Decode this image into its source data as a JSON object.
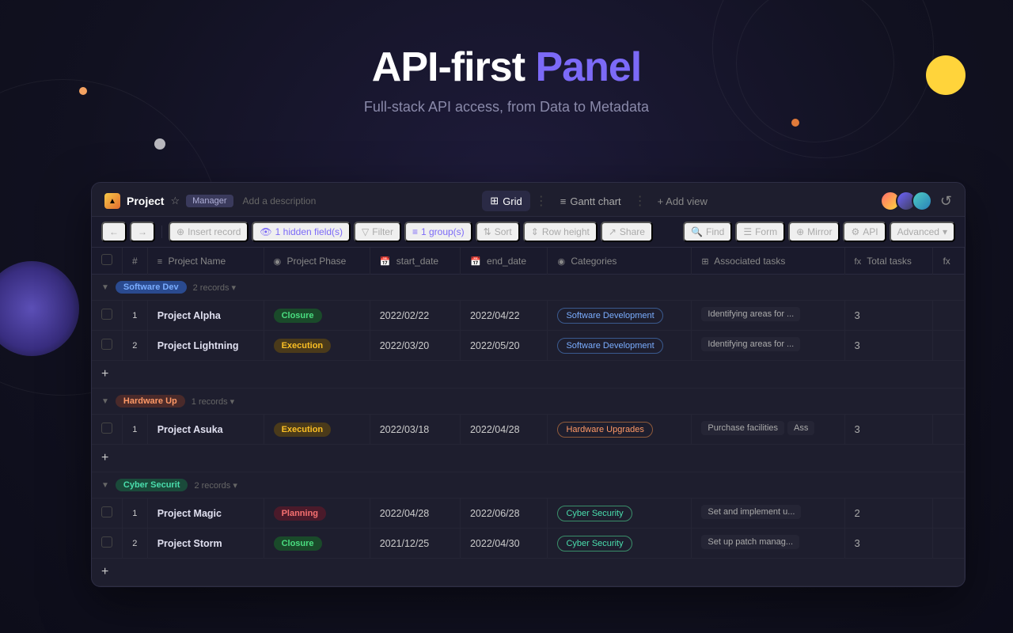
{
  "hero": {
    "title_plain": "API-first",
    "title_accent": "Panel",
    "subtitle": "Full-stack API access, from Data to Metadata"
  },
  "panel": {
    "project_label": "Project",
    "manager_badge": "Manager",
    "add_description": "Add a description",
    "tabs": [
      {
        "id": "grid",
        "icon": "⊞",
        "label": "Grid",
        "active": true
      },
      {
        "id": "gantt",
        "icon": "≡",
        "label": "Gantt chart",
        "active": false
      }
    ],
    "add_view_label": "+ Add view"
  },
  "toolbar": {
    "insert_record": "Insert record",
    "hidden_fields": "1 hidden field(s)",
    "filter": "Filter",
    "group": "1 group(s)",
    "sort": "Sort",
    "row_height": "Row height",
    "share": "Share",
    "find": "Find",
    "form": "Form",
    "mirror": "Mirror",
    "api": "API",
    "advanced": "Advanced"
  },
  "table": {
    "columns": [
      {
        "id": "project_name",
        "icon": "≡",
        "label": "Project Name"
      },
      {
        "id": "project_phase",
        "icon": "◉",
        "label": "Project Phase"
      },
      {
        "id": "start_date",
        "icon": "📅",
        "label": "start_date"
      },
      {
        "id": "end_date",
        "icon": "📅",
        "label": "end_date"
      },
      {
        "id": "categories",
        "icon": "◉",
        "label": "Categories"
      },
      {
        "id": "associated_tasks",
        "icon": "⊞",
        "label": "Associated tasks"
      },
      {
        "id": "total_tasks",
        "icon": "fx",
        "label": "Total tasks"
      }
    ],
    "groups": [
      {
        "id": "software-dev",
        "tag": "Software Dev",
        "tag_class": "software-dev",
        "record_count": "2 records",
        "rows": [
          {
            "num": 1,
            "name": "Project Alpha",
            "phase": "Closure",
            "phase_class": "phase-closure",
            "start_date": "2022/02/22",
            "end_date": "2022/04/22",
            "category": "Software Development",
            "category_class": "category-software",
            "tasks": [
              "Identifying areas for ..."
            ],
            "total": 3
          },
          {
            "num": 2,
            "name": "Project Lightning",
            "phase": "Execution",
            "phase_class": "phase-execution",
            "start_date": "2022/03/20",
            "end_date": "2022/05/20",
            "category": "Software Development",
            "category_class": "category-software",
            "tasks": [
              "Identifying areas for ..."
            ],
            "total": 3
          }
        ]
      },
      {
        "id": "hardware-up",
        "tag": "Hardware Up",
        "tag_class": "hardware-up",
        "record_count": "1 records",
        "rows": [
          {
            "num": 1,
            "name": "Project Asuka",
            "phase": "Execution",
            "phase_class": "phase-execution",
            "start_date": "2022/03/18",
            "end_date": "2022/04/28",
            "category": "Hardware Upgrades",
            "category_class": "category-hardware",
            "tasks": [
              "Purchase facilities",
              "Ass"
            ],
            "total": 3
          }
        ]
      },
      {
        "id": "cyber-sec",
        "tag": "Cyber Securit",
        "tag_class": "cyber-sec",
        "record_count": "2 records",
        "rows": [
          {
            "num": 1,
            "name": "Project Magic",
            "phase": "Planning",
            "phase_class": "phase-planning",
            "start_date": "2022/04/28",
            "end_date": "2022/06/28",
            "category": "Cyber Security",
            "category_class": "category-cyber",
            "tasks": [
              "Set and implement u..."
            ],
            "total": 2
          },
          {
            "num": 2,
            "name": "Project Storm",
            "phase": "Closure",
            "phase_class": "phase-closure",
            "start_date": "2021/12/25",
            "end_date": "2022/04/30",
            "category": "Cyber Security",
            "category_class": "category-cyber",
            "tasks": [
              "Set up patch manag..."
            ],
            "total": 3
          }
        ]
      }
    ]
  }
}
